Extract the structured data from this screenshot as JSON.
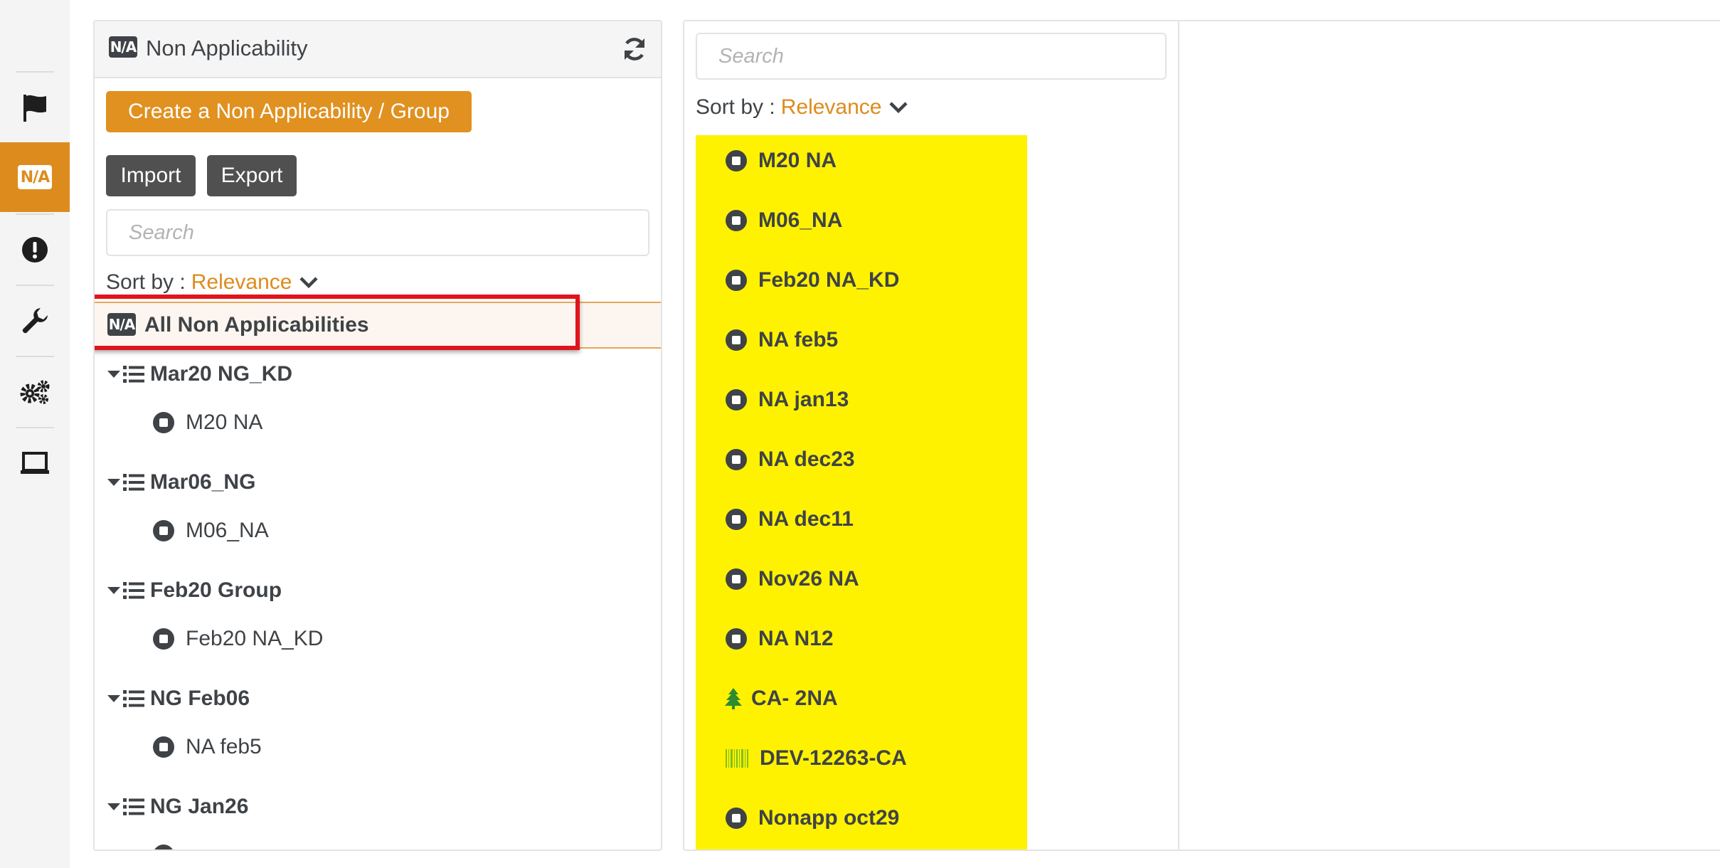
{
  "sidebar": {
    "items": [
      {
        "icon": "flag-icon",
        "active": false
      },
      {
        "icon": "na-icon",
        "label": "N/A",
        "active": true
      },
      {
        "icon": "alert-circle-icon",
        "active": false
      },
      {
        "icon": "wrench-icon",
        "active": false
      },
      {
        "icon": "gears-icon",
        "active": false
      },
      {
        "icon": "laptop-icon",
        "active": false
      }
    ],
    "accent_color": "#de8b1d"
  },
  "na_panel": {
    "badge": "N/A",
    "title": "Non Applicability",
    "refresh_icon": "refresh-icon",
    "create_label": "Create a Non Applicability / Group",
    "import_label": "Import",
    "export_label": "Export",
    "search_placeholder": "Search",
    "sort_label": "Sort by :",
    "sort_value": "Relevance",
    "all_badge": "N/A",
    "all_label": "All Non Applicabilities",
    "groups": [
      {
        "label": "Mar20 NG_KD",
        "children": [
          "M20 NA"
        ]
      },
      {
        "label": "Mar06_NG",
        "children": [
          "M06_NA"
        ]
      },
      {
        "label": "Feb20 Group",
        "children": [
          "Feb20 NA_KD"
        ]
      },
      {
        "label": "NG Feb06",
        "children": [
          "NA feb5"
        ]
      },
      {
        "label": "NG Jan26",
        "children": []
      }
    ]
  },
  "detail_panel": {
    "search_placeholder": "Search",
    "sort_label": "Sort by :",
    "sort_value": "Relevance",
    "items": [
      {
        "label": "M20 NA",
        "icon": "stop-circle-icon"
      },
      {
        "label": "M06_NA",
        "icon": "stop-circle-icon"
      },
      {
        "label": "Feb20 NA_KD",
        "icon": "stop-circle-icon"
      },
      {
        "label": "NA feb5",
        "icon": "stop-circle-icon"
      },
      {
        "label": "NA jan13",
        "icon": "stop-circle-icon"
      },
      {
        "label": "NA dec23",
        "icon": "stop-circle-icon"
      },
      {
        "label": "NA dec11",
        "icon": "stop-circle-icon"
      },
      {
        "label": "Nov26 NA",
        "icon": "stop-circle-icon"
      },
      {
        "label": "NA N12",
        "icon": "stop-circle-icon"
      },
      {
        "label": "CA- 2NA",
        "icon": "tree-icon"
      },
      {
        "label": "DEV-12263-CA",
        "icon": "barcode-icon"
      },
      {
        "label": "Nonapp oct29",
        "icon": "stop-circle-icon"
      }
    ],
    "highlight_color": "#fff200"
  }
}
